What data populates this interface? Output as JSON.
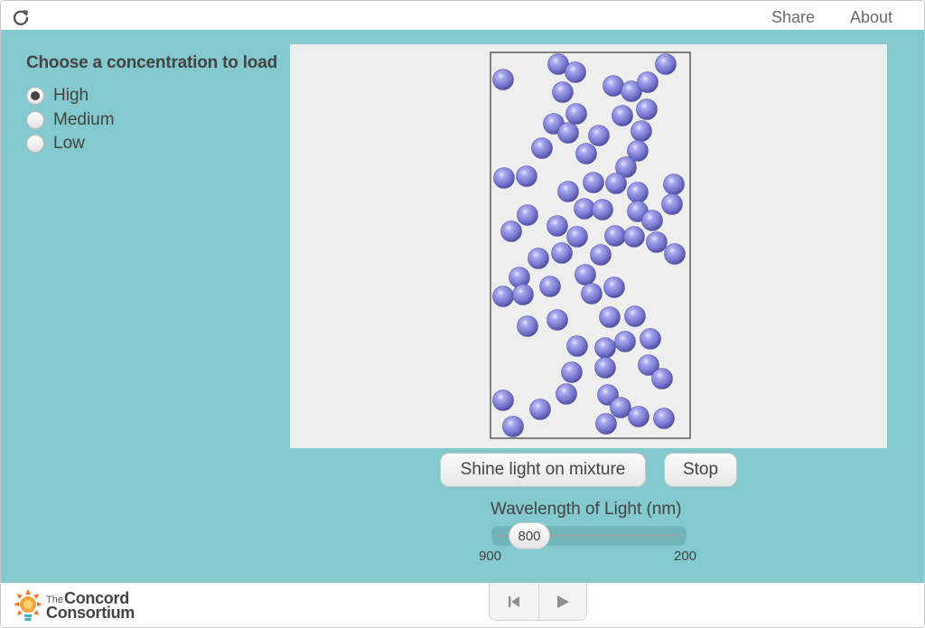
{
  "topbar": {
    "reload_icon": "reload-icon",
    "share_label": "Share",
    "about_label": "About"
  },
  "side_panel": {
    "title": "Choose a concentration to load",
    "options": [
      {
        "label": "High",
        "checked": true
      },
      {
        "label": "Medium",
        "checked": false
      },
      {
        "label": "Low",
        "checked": false
      }
    ]
  },
  "buttons": {
    "shine_label": "Shine light on mixture",
    "stop_label": "Stop"
  },
  "slider": {
    "title": "Wavelength of Light (nm)",
    "value": "800",
    "min_label": "900",
    "max_label": "200"
  },
  "footer": {
    "logo_the": "The",
    "logo_concord": "Concord",
    "logo_consortium": "Consortium",
    "rewind_icon": "step-back-icon",
    "play_icon": "play-icon"
  },
  "colors": {
    "teal_background": "#83c9cd",
    "model_background": "#eeeeee",
    "particle": "#7c7cd4"
  }
}
